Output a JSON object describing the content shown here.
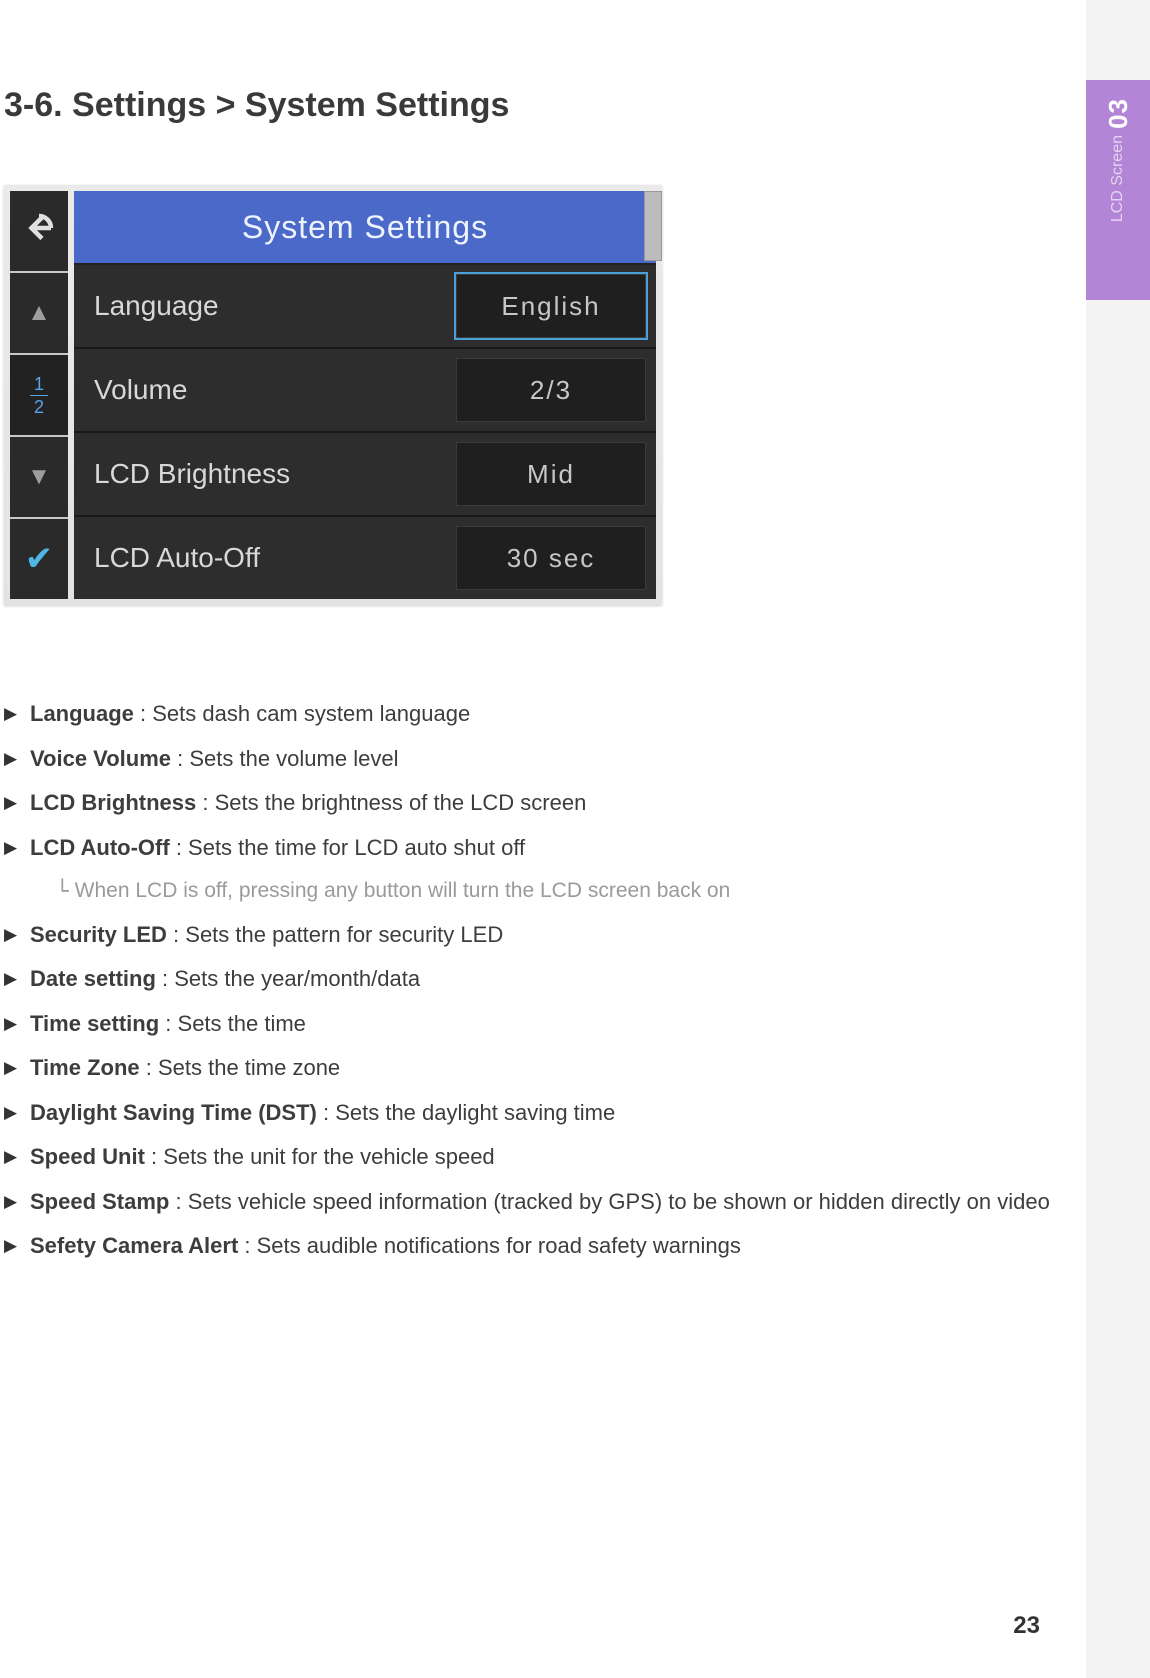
{
  "side_tab": {
    "chapter": "03",
    "title": "LCD Screen"
  },
  "heading": "3-6. Settings > System Settings",
  "device": {
    "title": "System Settings",
    "page_top": "1",
    "page_bot": "2",
    "rows": [
      {
        "label": "Language",
        "value": "English",
        "selected": true
      },
      {
        "label": "Volume",
        "value": "2/3",
        "selected": false
      },
      {
        "label": "LCD Brightness",
        "value": "Mid",
        "selected": false
      },
      {
        "label": "LCD Auto-Off",
        "value": "30 sec",
        "selected": false
      }
    ]
  },
  "bullets": [
    {
      "term": "Language",
      "desc": " : Sets dash cam system language"
    },
    {
      "term": "Voice Volume",
      "desc": " : Sets the volume level"
    },
    {
      "term": "LCD Brightness",
      "desc": " : Sets the brightness of the LCD screen"
    },
    {
      "term": "LCD Auto-Off",
      "desc": " : Sets the time for LCD auto shut off",
      "sub": "When LCD is off, pressing any button will turn the LCD screen back on"
    },
    {
      "term": "Security LED",
      "desc": " : Sets the pattern for security LED"
    },
    {
      "term": "Date setting",
      "desc": " : Sets the year/month/data"
    },
    {
      "term": "Time setting",
      "desc": " : Sets the time"
    },
    {
      "term": "Time Zone",
      "desc": " : Sets the time zone"
    },
    {
      "term": "Daylight Saving Time (DST)",
      "desc": " : Sets the daylight saving time"
    },
    {
      "term": "Speed Unit",
      "desc": " : Sets the unit for the vehicle speed"
    },
    {
      "term": "Speed Stamp",
      "desc": " : Sets vehicle speed information (tracked by GPS) to be shown or hidden directly on video"
    },
    {
      "term": "Sefety Camera Alert",
      "desc": " : Sets audible notifications for road safety warnings"
    }
  ],
  "page_number": "23"
}
